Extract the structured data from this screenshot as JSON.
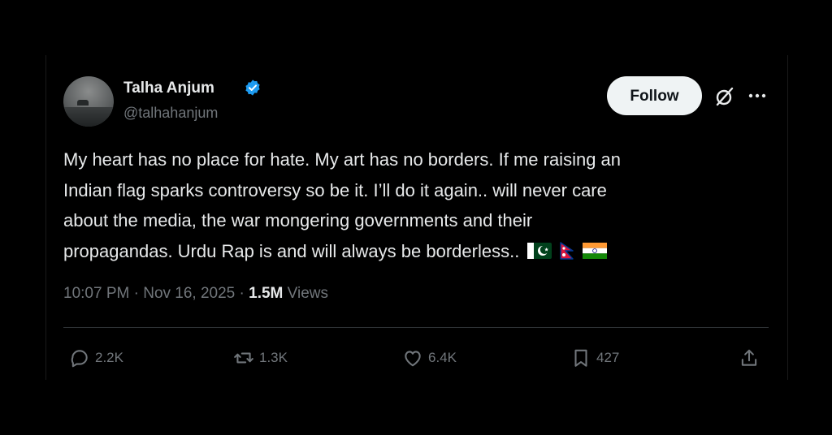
{
  "author": {
    "name": "Talha Anjum",
    "handle": "@talhahanjum",
    "verified": true
  },
  "buttons": {
    "follow_label": "Follow"
  },
  "tweet": {
    "lines": [
      "My heart has no place for hate. My art has no borders. If me raising an",
      "Indian flag sparks controversy so be it. I’ll do it again.. will never care",
      "about the media, the war mongering governments and their",
      "propagandas. Urdu Rap is and will always be borderless.."
    ],
    "flags": [
      "pakistan-flag",
      "nepal-flag",
      "india-flag"
    ]
  },
  "meta": {
    "time": "10:07 PM",
    "separator": "·",
    "date": "Nov 16, 2025",
    "views_count": "1.5M",
    "views_label": "Views"
  },
  "actions": {
    "replies": "2.2K",
    "reposts": "1.3K",
    "likes": "6.4K",
    "bookmarks": "427"
  },
  "colors": {
    "background": "#000000",
    "text": "#e7e9ea",
    "muted": "#71767b",
    "verified": "#1d9bf0",
    "follow_bg": "#eff3f4",
    "divider": "#2f3336"
  },
  "icons": {
    "reply": "reply-icon",
    "repost": "repost-icon",
    "like": "like-icon",
    "bookmark": "bookmark-icon",
    "share": "share-icon",
    "grok": "grok-icon",
    "more": "more-icon",
    "verified": "verified-badge-icon"
  }
}
